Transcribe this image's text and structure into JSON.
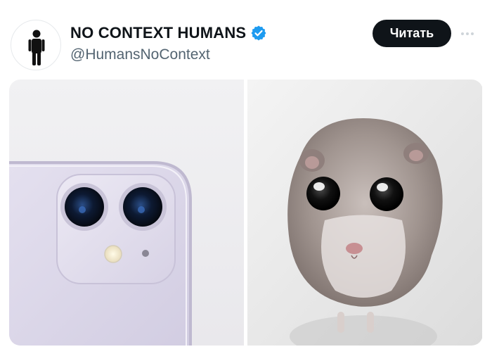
{
  "tweet": {
    "display_name": "NO CONTEXT HUMANS",
    "handle": "@HumansNoContext",
    "follow_label": "Читать",
    "verified_icon": "verified-badge-icon",
    "more_icon": "more-options-icon",
    "accent_color": "#1d9bf0"
  },
  "media": {
    "photos": [
      {
        "subject": "phone-camera-photo"
      },
      {
        "subject": "hamster-photo"
      }
    ]
  }
}
